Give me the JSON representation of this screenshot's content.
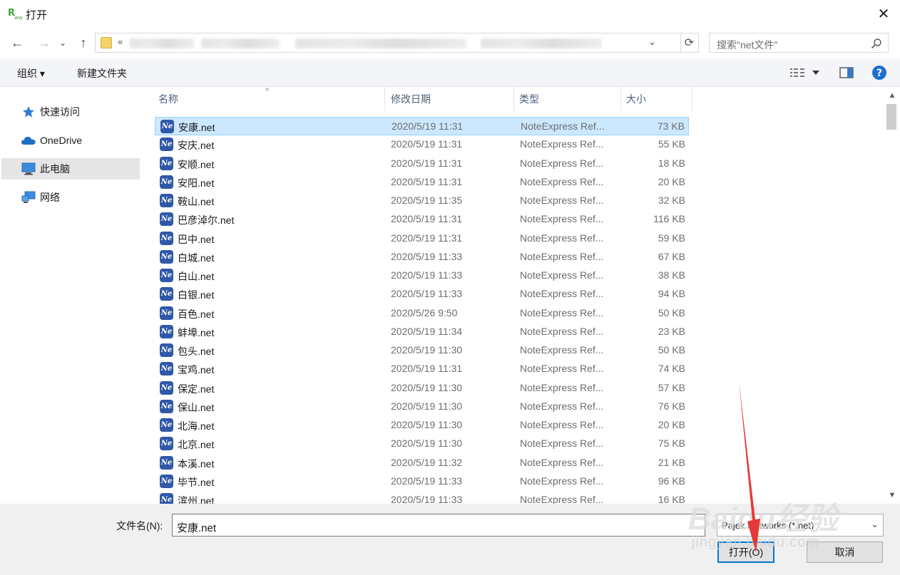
{
  "window": {
    "title": "打开",
    "close_glyph": "✕"
  },
  "nav": {
    "back": "←",
    "forward": "→",
    "recent": "⌄",
    "up": "↑",
    "path_prefix": "«",
    "dropdown": "⌄",
    "refresh": "⟳",
    "search_placeholder": "搜索\"net文件\""
  },
  "toolbar": {
    "organize": "组织 ▾",
    "new_folder": "新建文件夹"
  },
  "sidebar": {
    "items": [
      {
        "label": "快速访问",
        "icon": "star-icon"
      },
      {
        "label": "OneDrive",
        "icon": "cloud-icon"
      },
      {
        "label": "此电脑",
        "icon": "computer-icon"
      },
      {
        "label": "网络",
        "icon": "network-icon"
      }
    ]
  },
  "columns": {
    "name": "名称",
    "modified": "修改日期",
    "type": "类型",
    "size": "大小"
  },
  "files": [
    {
      "name": "安康.net",
      "date": "2020/5/19 11:31",
      "type": "NoteExpress Ref...",
      "size": "73 KB"
    },
    {
      "name": "安庆.net",
      "date": "2020/5/19 11:31",
      "type": "NoteExpress Ref...",
      "size": "55 KB"
    },
    {
      "name": "安顺.net",
      "date": "2020/5/19 11:31",
      "type": "NoteExpress Ref...",
      "size": "18 KB"
    },
    {
      "name": "安阳.net",
      "date": "2020/5/19 11:31",
      "type": "NoteExpress Ref...",
      "size": "20 KB"
    },
    {
      "name": "鞍山.net",
      "date": "2020/5/19 11:35",
      "type": "NoteExpress Ref...",
      "size": "32 KB"
    },
    {
      "name": "巴彦淖尔.net",
      "date": "2020/5/19 11:31",
      "type": "NoteExpress Ref...",
      "size": "116 KB"
    },
    {
      "name": "巴中.net",
      "date": "2020/5/19 11:31",
      "type": "NoteExpress Ref...",
      "size": "59 KB"
    },
    {
      "name": "白城.net",
      "date": "2020/5/19 11:33",
      "type": "NoteExpress Ref...",
      "size": "67 KB"
    },
    {
      "name": "白山.net",
      "date": "2020/5/19 11:33",
      "type": "NoteExpress Ref...",
      "size": "38 KB"
    },
    {
      "name": "白银.net",
      "date": "2020/5/19 11:33",
      "type": "NoteExpress Ref...",
      "size": "94 KB"
    },
    {
      "name": "百色.net",
      "date": "2020/5/26 9:50",
      "type": "NoteExpress Ref...",
      "size": "50 KB"
    },
    {
      "name": "蚌埠.net",
      "date": "2020/5/19 11:34",
      "type": "NoteExpress Ref...",
      "size": "23 KB"
    },
    {
      "name": "包头.net",
      "date": "2020/5/19 11:30",
      "type": "NoteExpress Ref...",
      "size": "50 KB"
    },
    {
      "name": "宝鸡.net",
      "date": "2020/5/19 11:31",
      "type": "NoteExpress Ref...",
      "size": "74 KB"
    },
    {
      "name": "保定.net",
      "date": "2020/5/19 11:30",
      "type": "NoteExpress Ref...",
      "size": "57 KB"
    },
    {
      "name": "保山.net",
      "date": "2020/5/19 11:30",
      "type": "NoteExpress Ref...",
      "size": "76 KB"
    },
    {
      "name": "北海.net",
      "date": "2020/5/19 11:30",
      "type": "NoteExpress Ref...",
      "size": "20 KB"
    },
    {
      "name": "北京.net",
      "date": "2020/5/19 11:30",
      "type": "NoteExpress Ref...",
      "size": "75 KB"
    },
    {
      "name": "本溪.net",
      "date": "2020/5/19 11:32",
      "type": "NoteExpress Ref...",
      "size": "21 KB"
    },
    {
      "name": "毕节.net",
      "date": "2020/5/19 11:33",
      "type": "NoteExpress Ref...",
      "size": "96 KB"
    },
    {
      "name": "滨州.net",
      "date": "2020/5/19 11:33",
      "type": "NoteExpress Ref...",
      "size": "16 KB"
    }
  ],
  "bottom": {
    "filename_label": "文件名(N):",
    "filename_value": "安康.net",
    "filter_value": "Pajek Networks (*.net)",
    "open_button": "打开(O)",
    "cancel_button": "取消"
  },
  "watermark": {
    "brand": "Baidu经验",
    "url": "jingyan.baidu.com"
  },
  "colors": {
    "selection": "#cce8ff",
    "selection_border": "#99d1ff",
    "header_text": "#4c607a",
    "accent": "#0078d7",
    "annotation_arrow": "#e53935"
  }
}
